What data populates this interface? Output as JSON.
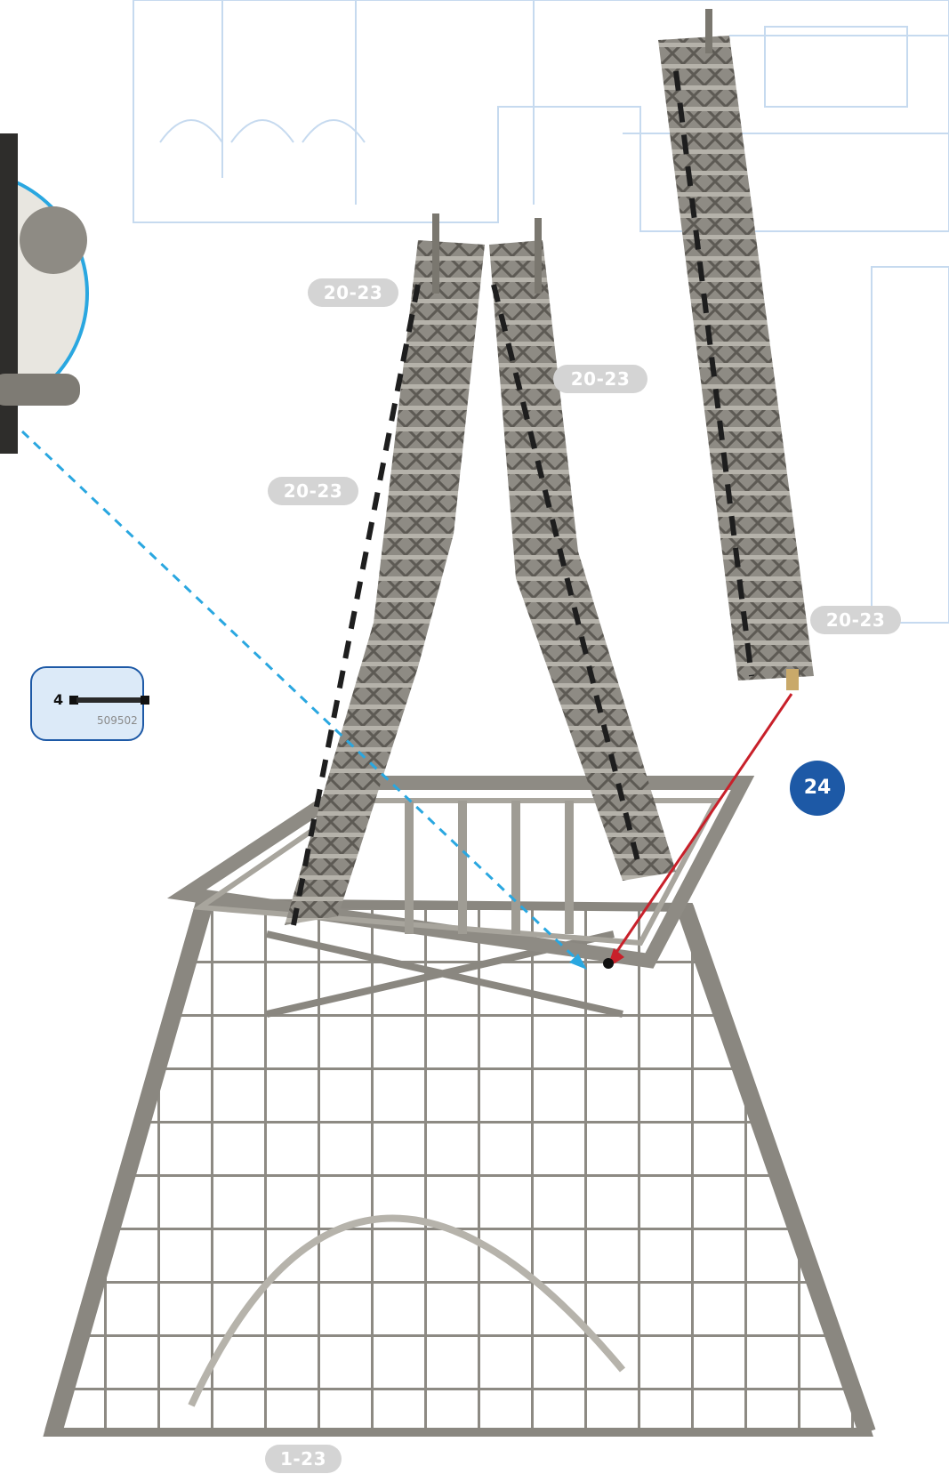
{
  "callouts": {
    "top_left": "20-23",
    "top_right": "20-23",
    "mid_left": "20-23",
    "far_right": "20-23",
    "bottom": "1-23"
  },
  "step": {
    "number": "24"
  },
  "parts": {
    "quantity": "4",
    "part_number": "509502"
  },
  "colors": {
    "step_badge": "#1d59a6",
    "callout_badge": "#d4d4d4",
    "parts_bg": "#dceaf8",
    "arrow_red": "#c8202a",
    "arrow_blue": "#2aa7e0",
    "blueprint": "#b8d1ec"
  }
}
